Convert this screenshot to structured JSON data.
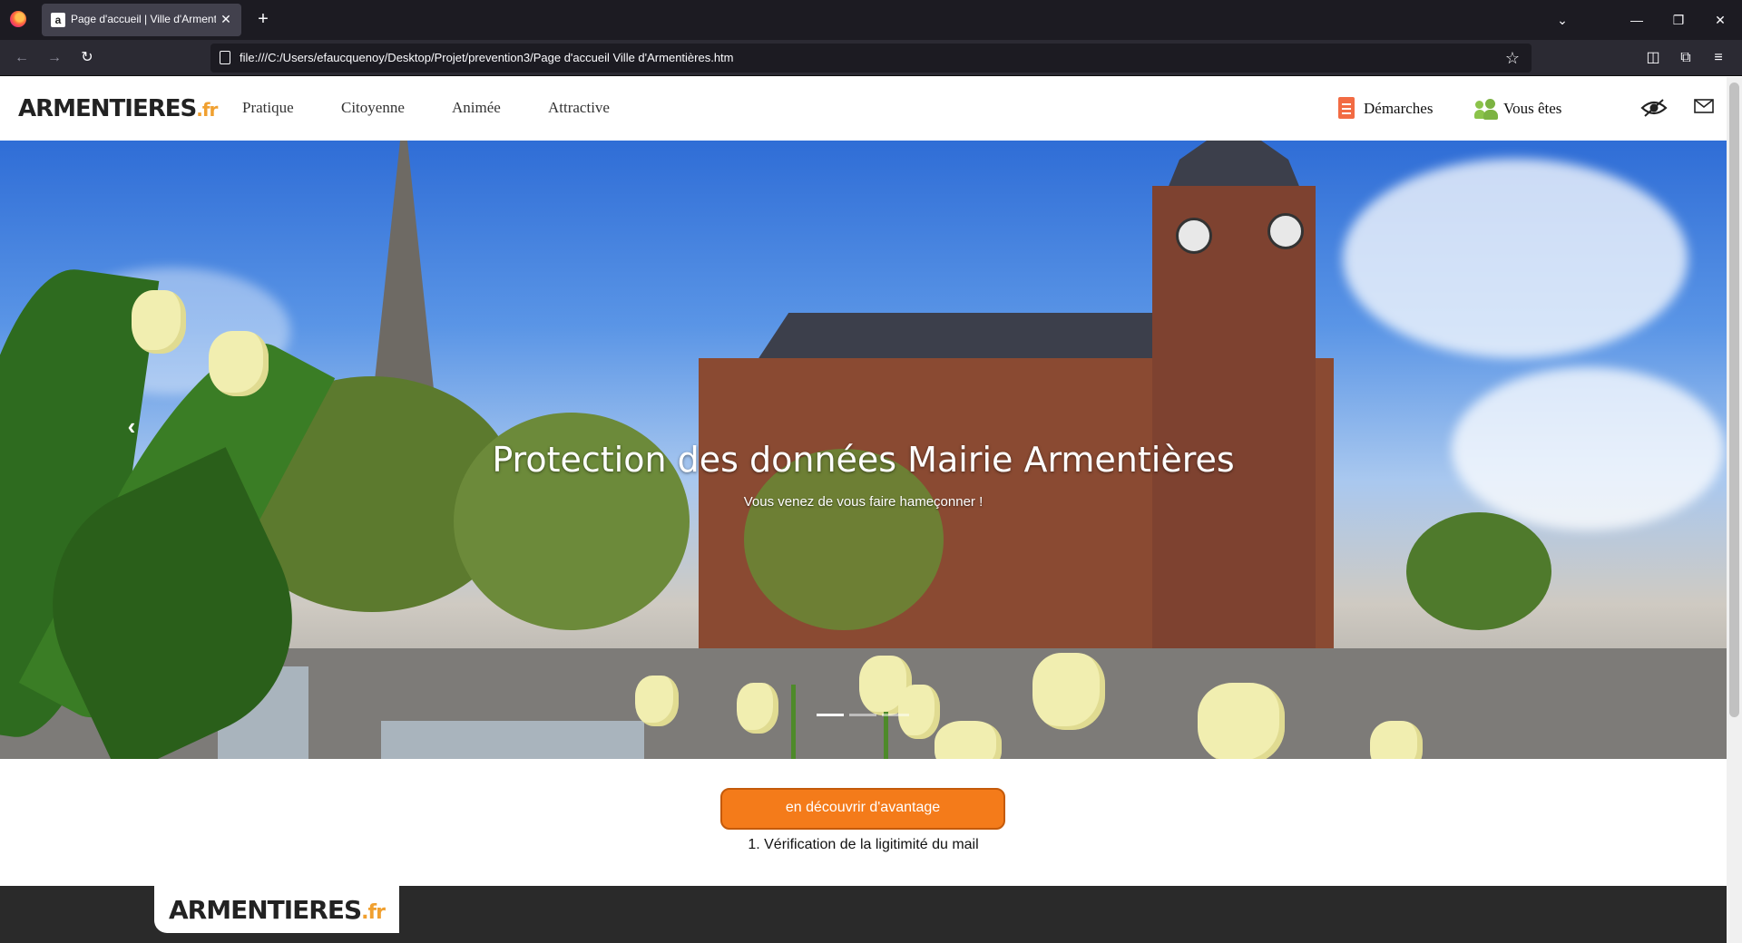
{
  "browser": {
    "tab_title": "Page d'accueil | Ville d'Armentières",
    "tab_favicon": "a",
    "url": "file:///C:/Users/efaucquenoy/Desktop/Projet/prevention3/Page d'accueil Ville d'Armentières.htm",
    "icons": {
      "new_tab": "+",
      "close_tab": "✕",
      "list_tabs": "⌄",
      "minimize": "—",
      "restore": "❐",
      "close_window": "✕",
      "back": "←",
      "forward": "→",
      "reload": "↻",
      "bookmark": "☆",
      "pocket": "◫",
      "extensions": "⧉",
      "menu": "≡"
    }
  },
  "site": {
    "logo_main": "ARMENTIERES",
    "logo_suffix": ".fr",
    "menu": [
      "Pratique",
      "Citoyenne",
      "Animée",
      "Attractive"
    ],
    "quick_links": {
      "demarches": "Démarches",
      "vous_etes": "Vous êtes"
    },
    "header_icons": {
      "accessibility": "eye-icon",
      "contact": "mail-icon"
    },
    "accent_color": "#f47b1a"
  },
  "hero": {
    "title": "Protection des données Mairie Armentières",
    "subtitle": "Vous venez de vous faire hameçonner !",
    "prev_arrow": "‹",
    "slide_count": 3,
    "active_slide": 1
  },
  "cta": {
    "button_label": "en découvrir d'avantage",
    "caption": "1. Vérification de la ligitimité du mail"
  },
  "footer": {
    "logo_main": "ARMENTIERES",
    "logo_suffix": ".fr"
  }
}
